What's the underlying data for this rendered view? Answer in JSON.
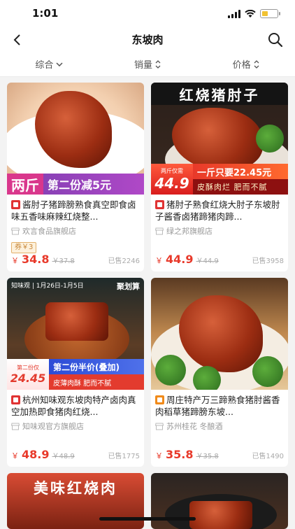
{
  "status": {
    "time": "1:01"
  },
  "nav": {
    "title": "东坡肉"
  },
  "sort": [
    {
      "label": "综合"
    },
    {
      "label": "销量"
    },
    {
      "label": "价格"
    }
  ],
  "products": [
    {
      "image_text_big": "两斤",
      "image_text_banner": "第二份减5元",
      "title": "酱肘子猪蹄膀熟食真空即食卤味五香味麻辣红烧整...",
      "shop": "欢言食品旗舰店",
      "coupon": "券￥3",
      "currency": "￥",
      "price": "34.8",
      "orig_price": "￥37.8",
      "sold": "已售2246",
      "store_icon": "tmall-icon"
    },
    {
      "image_head": "红烧猪肘子",
      "image_promo_small": "两斤仅需",
      "image_promo_price": "44.9",
      "image_promo_line1": "一斤只要22.45元",
      "image_promo_line2": "皮酥肉烂  肥而不腻",
      "title": "猪肘子熟食红烧大肘子东坡肘子酱香卤猪蹄猪肉蹄...",
      "shop": "绿之邦旗舰店",
      "currency": "￥",
      "price": "44.9",
      "orig_price": "￥44.9",
      "sold": "已售3958",
      "store_icon": "tmall-icon"
    },
    {
      "image_top_logo": "知味观 | 1月26日-1月5日",
      "image_top_badge": "聚划算",
      "image_promo_small": "第二份仅",
      "image_promo_price": "24.45",
      "image_promo_line1": "第二份半价(叠加)",
      "image_promo_line2": "皮薄肉酥  肥而不腻",
      "title": "杭州知味观东坡肉特产卤肉真空加热即食猪肉红烧...",
      "shop": "知味观官方旗舰店",
      "currency": "￥",
      "price": "48.9",
      "orig_price": "￥48.9",
      "sold": "已售1775",
      "store_icon": "tmall-icon"
    },
    {
      "title": "周庄特产万三蹄熟食猪肘酱香肉稻草猪蹄膀东坡...",
      "shop": "苏州桂花 冬酿酒",
      "currency": "￥",
      "price": "35.8",
      "orig_price": "￥35.8",
      "sold": "已售1490",
      "store_icon": "taobao-icon"
    },
    {
      "image_head": "美味红烧肉"
    },
    {}
  ],
  "colors": {
    "price": "#e8392a",
    "tmall": "#e03333",
    "taobao": "#f08a1a"
  }
}
